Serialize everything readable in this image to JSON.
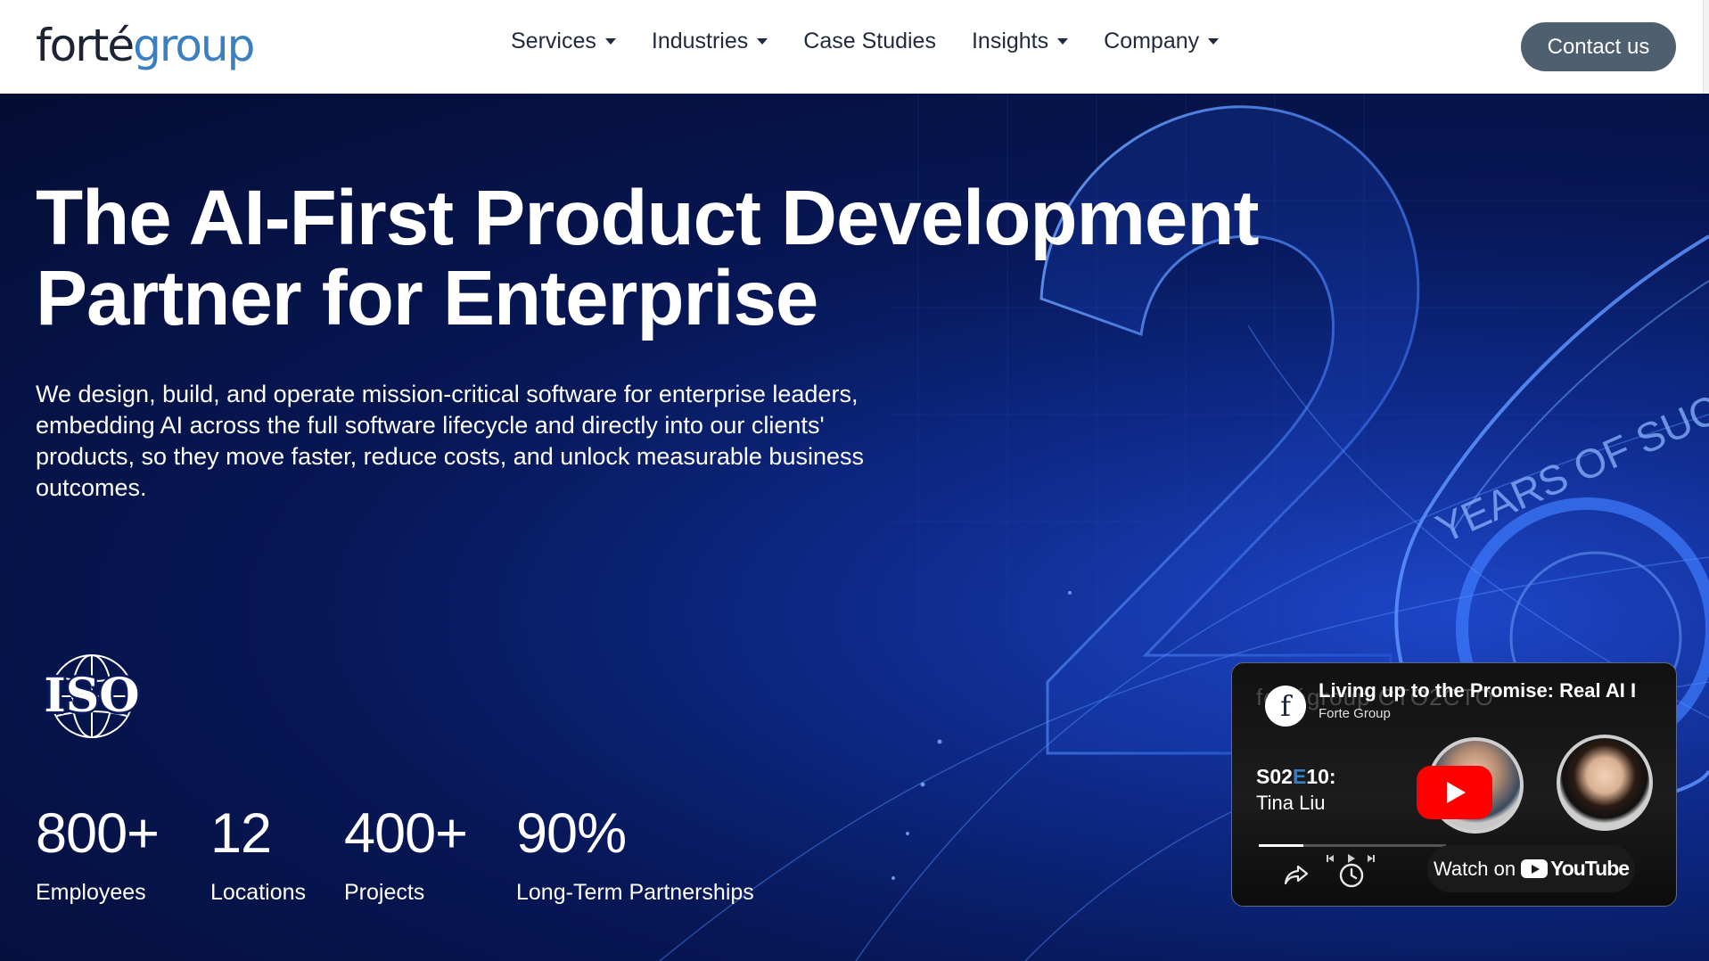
{
  "header": {
    "logo": {
      "part1": "forté",
      "part2": "group"
    },
    "nav": [
      {
        "label": "Services",
        "dropdown": true
      },
      {
        "label": "Industries",
        "dropdown": true
      },
      {
        "label": "Case Studies",
        "dropdown": false
      },
      {
        "label": "Insights",
        "dropdown": true
      },
      {
        "label": "Company",
        "dropdown": true
      }
    ],
    "contact_label": "Contact us"
  },
  "hero": {
    "title_line1": "The AI-First Product Development",
    "title_line2": "Partner for Enterprise",
    "description": "We design, build, and operate mission-critical software for enterprise leaders, embedding AI across the full software lifecycle and directly into our clients' products, so they move faster, reduce costs, and unlock measurable business outcomes.",
    "background_number": "26",
    "background_arc_text": "YEARS OF SUC",
    "iso_label": "ISO",
    "stats": [
      {
        "value": "800+",
        "label": "Employees"
      },
      {
        "value": "12",
        "label": "Locations"
      },
      {
        "value": "400+",
        "label": "Projects"
      },
      {
        "value": "90%",
        "label": "Long-Term Partnerships"
      }
    ]
  },
  "video": {
    "title": "Living up to the Promise: Real AI I",
    "channel": "Forte Group",
    "avatar_letter": "f",
    "watermark": "fortégroup CTO2CTO",
    "episode_prefix": "S02",
    "episode_e": "E",
    "episode_suffix": "10:",
    "guest": "Tina Liu",
    "watch_on": "Watch on",
    "youtube": "YouTube",
    "progress": 0.24
  },
  "colors": {
    "brand_dark": "#1c2433",
    "brand_blue": "#3a7fc1",
    "contact_button": "#4e5f70",
    "hero_bg": "#071756",
    "youtube_red": "#ff0000"
  },
  "icons": [
    "caret-down-icon",
    "iso-globe-icon",
    "play-icon",
    "share-icon",
    "clock-icon",
    "youtube-logo-icon"
  ]
}
